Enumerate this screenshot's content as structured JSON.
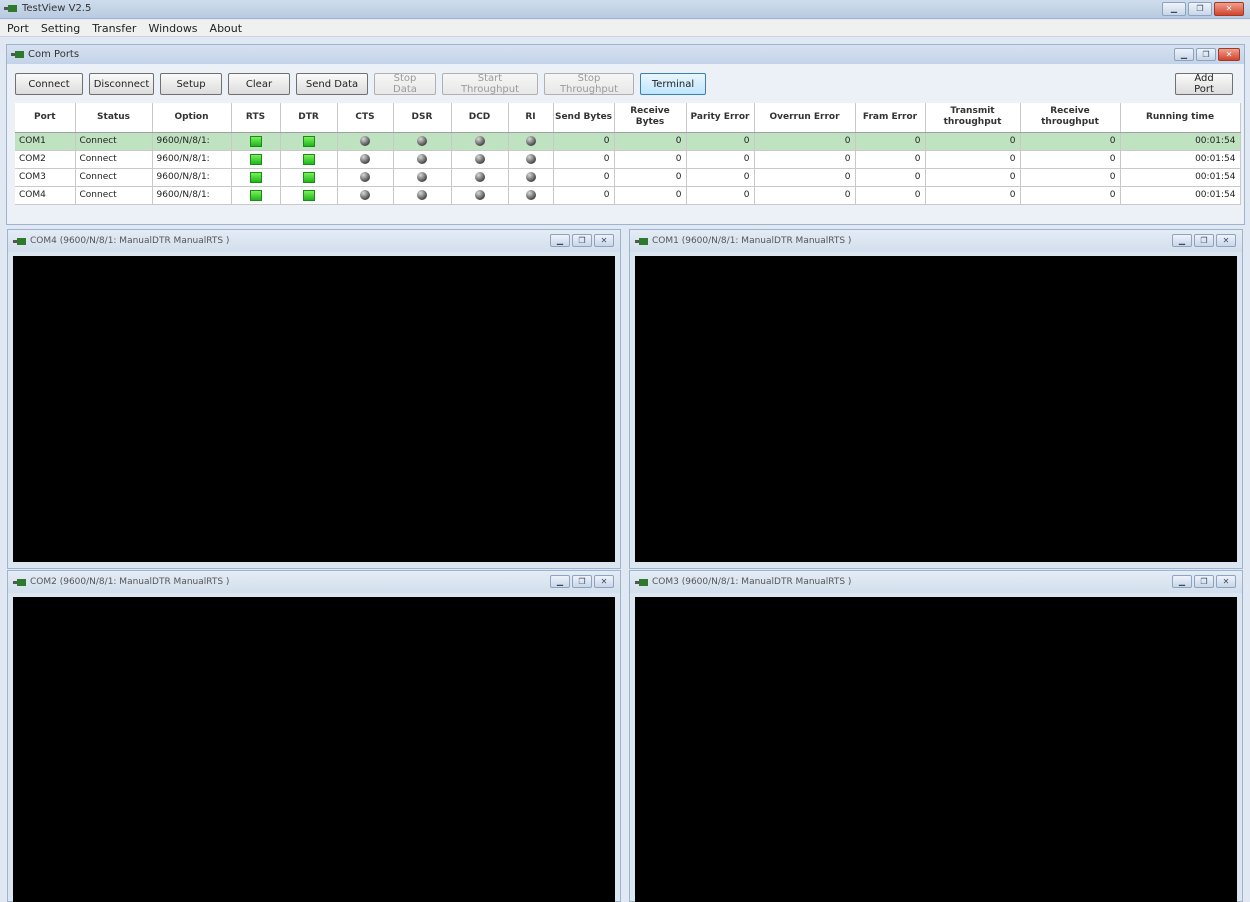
{
  "app": {
    "title": "TestView V2.5",
    "menu": [
      "Port",
      "Setting",
      "Transfer",
      "Windows",
      "About"
    ]
  },
  "comports": {
    "title": "Com Ports",
    "buttons": [
      {
        "label": "Connect",
        "enabled": true
      },
      {
        "label": "Disconnect",
        "enabled": true
      },
      {
        "label": "Setup",
        "enabled": true
      },
      {
        "label": "Clear",
        "enabled": true
      },
      {
        "label": "Send Data",
        "enabled": true
      },
      {
        "label": "Stop Data",
        "enabled": false
      },
      {
        "label": "Start Throughput",
        "enabled": false
      },
      {
        "label": "Stop Throughput",
        "enabled": false
      },
      {
        "label": "Terminal",
        "enabled": true
      }
    ],
    "add_port_label": "Add Port",
    "columns": [
      "Port",
      "Status",
      "Option",
      "RTS",
      "DTR",
      "CTS",
      "DSR",
      "DCD",
      "RI",
      "Send Bytes",
      "Receive Bytes",
      "Parity Error",
      "Overrun Error",
      "Fram Error",
      "Transmit throughput",
      "Receive throughput",
      "Running time"
    ],
    "rows": [
      {
        "port": "COM1",
        "status": "Connect",
        "option": "9600/N/8/1:",
        "send": "0",
        "receive": "0",
        "parity": "0",
        "overrun": "0",
        "fram": "0",
        "tx": "0",
        "rx": "0",
        "time": "00:01:54",
        "selected": true
      },
      {
        "port": "COM2",
        "status": "Connect",
        "option": "9600/N/8/1:",
        "send": "0",
        "receive": "0",
        "parity": "0",
        "overrun": "0",
        "fram": "0",
        "tx": "0",
        "rx": "0",
        "time": "00:01:54",
        "selected": false
      },
      {
        "port": "COM3",
        "status": "Connect",
        "option": "9600/N/8/1:",
        "send": "0",
        "receive": "0",
        "parity": "0",
        "overrun": "0",
        "fram": "0",
        "tx": "0",
        "rx": "0",
        "time": "00:01:54",
        "selected": false
      },
      {
        "port": "COM4",
        "status": "Connect",
        "option": "9600/N/8/1:",
        "send": "0",
        "receive": "0",
        "parity": "0",
        "overrun": "0",
        "fram": "0",
        "tx": "0",
        "rx": "0",
        "time": "00:01:54",
        "selected": false
      }
    ],
    "row_selected_color": "#bfe2c0",
    "led_color": "#2fc21f"
  },
  "terminals": [
    {
      "title": "COM4 (9600/N/8/1: ManualDTR ManualRTS )"
    },
    {
      "title": "COM1 (9600/N/8/1: ManualDTR ManualRTS )"
    },
    {
      "title": "COM2 (9600/N/8/1: ManualDTR ManualRTS )"
    },
    {
      "title": "COM3 (9600/N/8/1: ManualDTR ManualRTS )"
    }
  ],
  "icons": {
    "app": "plug-icon",
    "minimize": "minimize-icon",
    "maximize": "maximize-icon",
    "close": "close-icon"
  }
}
